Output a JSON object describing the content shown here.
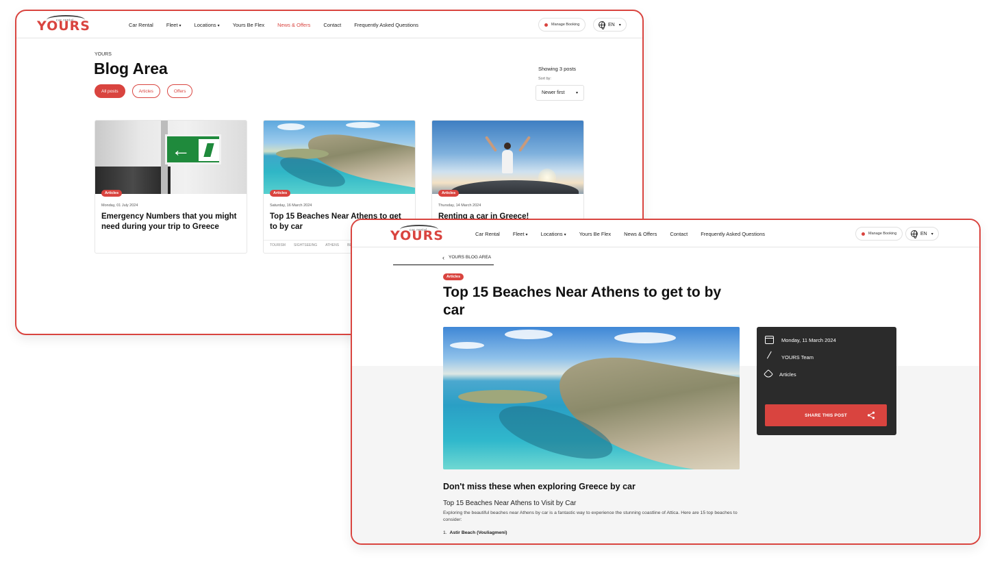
{
  "brand": {
    "logo_word": "YOURS",
    "logo_sub": "car rental"
  },
  "nav": {
    "items": [
      "Car Rental",
      "Fleet",
      "Locations",
      "Yours Be Flex",
      "News & Offers",
      "Contact",
      "Frequently Asked Questions"
    ],
    "active": "News & Offers",
    "manage_booking": "Manage Booking",
    "language": "EN"
  },
  "blog": {
    "eyebrow": "YOURS",
    "title": "Blog Area",
    "filters": [
      "All posts",
      "Articles",
      "Offers"
    ],
    "showing": "Showing 3 posts",
    "sort_label": "Sort by:",
    "sort_value": "Newer first",
    "cards": [
      {
        "badge": "Articles",
        "date": "Monday, 01 July 2024",
        "title": "Emergency Numbers that you might need during your trip to Greece",
        "tags": []
      },
      {
        "badge": "Articles",
        "date": "Saturday, 16 March 2024",
        "title": "Top 15 Beaches Near Athens to get to by car",
        "tags": [
          "TOURISM",
          "SIGHTSEEING",
          "ATHENS",
          "BEA"
        ]
      },
      {
        "badge": "Articles",
        "date": "Thursday, 14 March 2024",
        "title": "Renting a car in Greece!",
        "tags": []
      }
    ]
  },
  "article": {
    "back_label": "YOURS BLOG AREA",
    "badge": "Articles",
    "title": "Top 15 Beaches Near Athens to get to by car",
    "meta": {
      "date": "Monday, 11 March 2024",
      "author": "YOURS Team",
      "category": "Articles",
      "share": "SHARE THIS POST"
    },
    "h2": "Don't miss these when exploring Greece by car",
    "h3": "Top 15 Beaches Near Athens to Visit by Car",
    "paragraph": "Exploring the beautiful beaches near Athens by car is a fantastic way to experience the stunning coastline of Attica. Here are 15 top beaches to consider:",
    "list_num": "1.",
    "list_item": "Astir Beach (Vouliagmeni)"
  },
  "colors": {
    "accent": "#d9443f",
    "dark_panel": "#2b2b2b"
  }
}
